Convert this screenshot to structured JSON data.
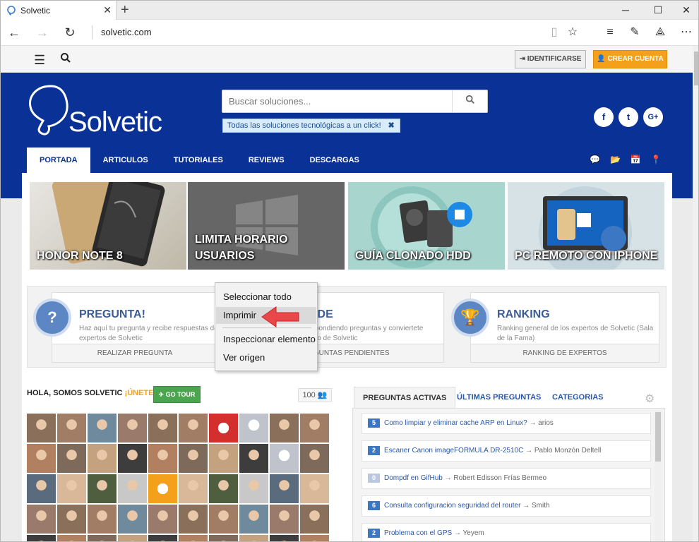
{
  "browser": {
    "tab_title": "Solvetic",
    "url": "solvetic.com"
  },
  "topbar": {
    "login_label": "IDENTIFICARSE",
    "signup_label": "CREAR CUENTA"
  },
  "header": {
    "logo_text": "Solvetic",
    "search_placeholder": "Buscar soluciones...",
    "hint": "Todas las soluciones tecnológicas a un click!",
    "social": [
      "f",
      "t",
      "G+"
    ]
  },
  "nav": {
    "items": [
      "PORTADA",
      "ARTICULOS",
      "TUTORIALES",
      "REVIEWS",
      "DESCARGAS"
    ]
  },
  "tiles": [
    {
      "caption": "HONOR NOTE 8"
    },
    {
      "caption": "LIMITA HORARIO USUARIOS"
    },
    {
      "caption": "GUÍA CLONADO HDD"
    },
    {
      "caption": "PC REMOTO CON IPHONE"
    }
  ],
  "features": [
    {
      "title": "PREGUNTA!",
      "desc": "Haz aquí tu pregunta y recibe respuestas de expertos de Solvetic",
      "button": "REALIZAR PREGUNTA"
    },
    {
      "title": "NDE",
      "desc": "respondiendo preguntas y conviertete perto de Solvetic",
      "button": "REGUNTAS PENDIENTES"
    },
    {
      "title": "RANKING",
      "desc": "Ranking general de los expertos de Solvetic (Sala de la Fama)",
      "button": "RANKING DE EXPERTOS"
    }
  ],
  "context_menu": {
    "items": [
      "Seleccionar todo",
      "Imprimir",
      "Inspeccionar elemento",
      "Ver origen"
    ]
  },
  "community": {
    "heading": "HOLA, SOMOS SOLVETIC",
    "join": "¡ÚNETE!",
    "tour_label": "GO TOUR",
    "count": "100"
  },
  "questions": {
    "tabs": [
      "PREGUNTAS ACTIVAS",
      "ÚLTIMAS PREGUNTAS",
      "CATEGORIAS"
    ],
    "items": [
      {
        "count": "5",
        "title": "Como limpiar y eliminar cache ARP en Linux?",
        "author": "→ arios"
      },
      {
        "count": "2",
        "title": "Escaner Canon imageFORMULA DR-2510C",
        "author": "→ Pablo Monzón Deltell"
      },
      {
        "count": "0",
        "title": "Dompdf en GifHub",
        "author": "→ Robert Edisson Frías Bermeo"
      },
      {
        "count": "6",
        "title": "Consulta configuracion seguridad del router",
        "author": "→ Smith"
      },
      {
        "count": "2",
        "title": "Problema con el GPS",
        "author": "→ Yeyem"
      }
    ]
  },
  "colors": {
    "header_blue": "#0a3296",
    "accent_orange": "#f5a01a",
    "link_blue": "#2a57a8",
    "tour_green": "#4aa54e"
  }
}
